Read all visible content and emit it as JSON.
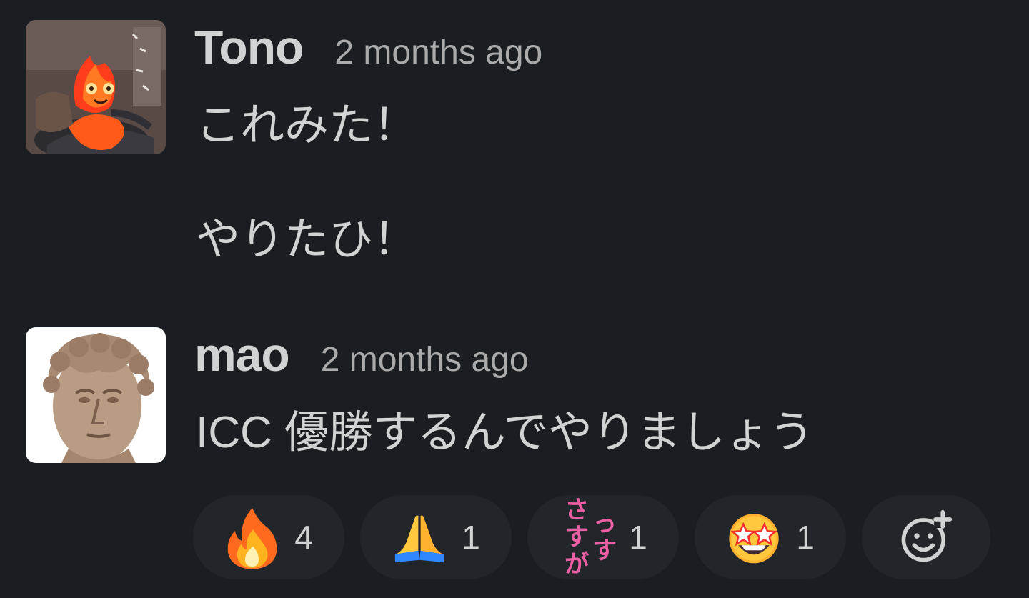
{
  "messages": [
    {
      "username": "Tono",
      "timestamp": "2 months ago",
      "lines": [
        "これみた！",
        "やりたひ！"
      ],
      "avatar_icon": "fire-demon-avatar"
    },
    {
      "username": "mao",
      "timestamp": "2 months ago",
      "lines": [
        "ICC 優勝するんでやりましょう"
      ],
      "avatar_icon": "statue-head-avatar",
      "reactions": [
        {
          "emoji_name": "fire-emoji",
          "count": "4"
        },
        {
          "emoji_name": "folded-hands-emoji",
          "count": "1"
        },
        {
          "emoji_name": "sasuga-custom-emoji",
          "emoji_text_top": "さすが",
          "emoji_text_bottom": "っす",
          "count": "1"
        },
        {
          "emoji_name": "star-struck-emoji",
          "count": "1"
        }
      ],
      "add_reaction_icon": "add-reaction-icon"
    }
  ],
  "colors": {
    "background": "#1a1d21",
    "reaction_pill": "#222529",
    "text_primary": "#d1d2d3",
    "text_secondary": "#ababad",
    "sasuga_pink": "#ec5fa5"
  }
}
